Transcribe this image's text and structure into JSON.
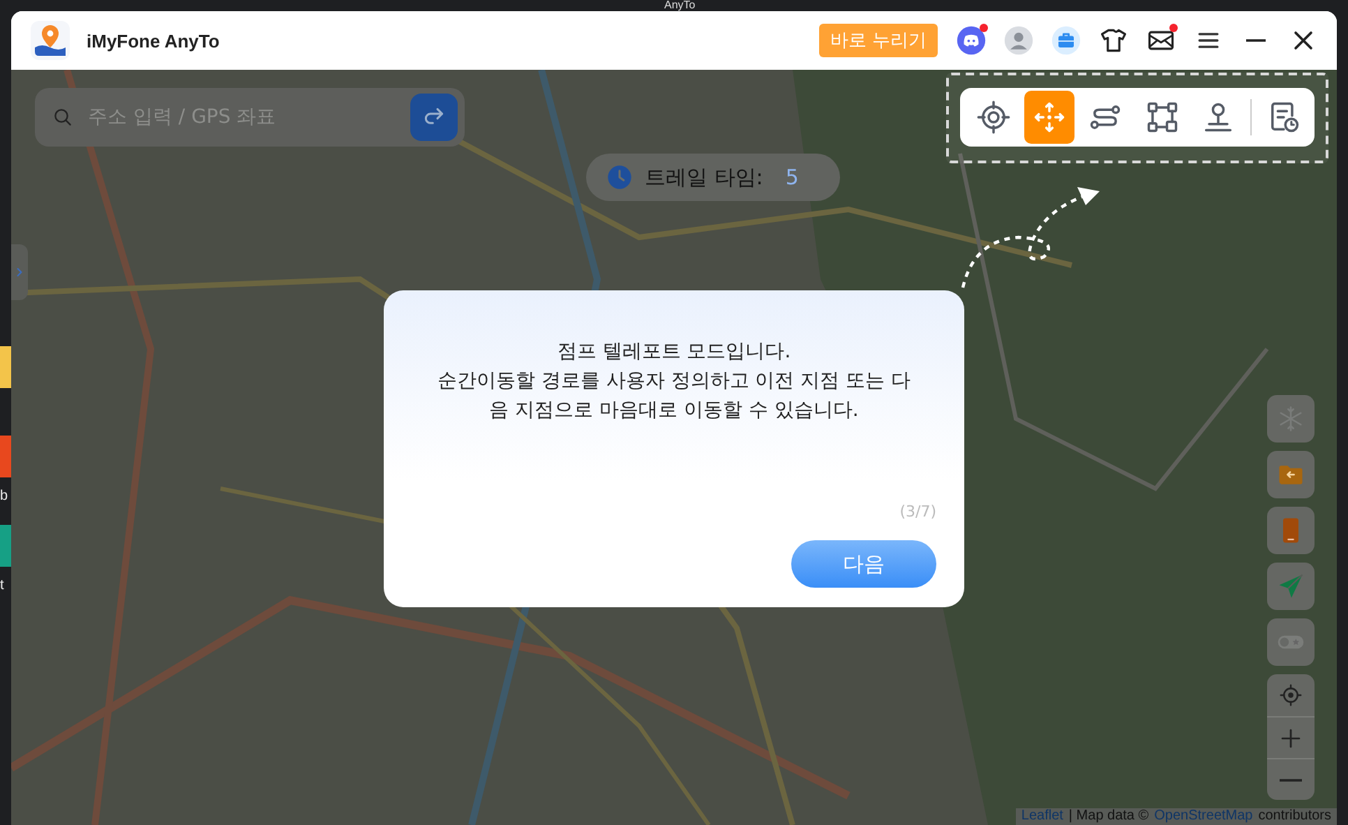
{
  "desktop": {
    "title": "AnyTo",
    "icon_labels": [
      "b",
      "t"
    ]
  },
  "window": {
    "title": "iMyFone AnyTo",
    "promo_button": "바로 누리기",
    "icons": [
      {
        "kind": "discord",
        "badge": true
      },
      {
        "kind": "user",
        "badge": false
      },
      {
        "kind": "briefcase",
        "badge": false
      },
      {
        "kind": "shirt",
        "badge": false
      },
      {
        "kind": "mail",
        "badge": true
      },
      {
        "kind": "menu",
        "badge": false
      },
      {
        "kind": "minimize",
        "badge": false
      },
      {
        "kind": "close",
        "badge": false
      }
    ]
  },
  "search": {
    "placeholder": "주소 입력 / GPS 좌표"
  },
  "trail_time": {
    "label": "트레일 타임:",
    "value": "5"
  },
  "mode_tools": [
    {
      "kind": "teleport",
      "selected": false
    },
    {
      "kind": "jump",
      "selected": true
    },
    {
      "kind": "two_spot",
      "selected": false
    },
    {
      "kind": "multi_spot",
      "selected": false
    },
    {
      "kind": "joystick",
      "selected": false
    },
    {
      "kind": "history",
      "selected": false
    }
  ],
  "tutorial": {
    "text": "점프 텔레포트 모드입니다.\n순간이동할 경로를 사용자 정의하고 이전 지점 또는 다\n음 지점으로 마음대로 이동할 수 있습니다.",
    "step": "(3/7)",
    "next_button": "다음"
  },
  "side_tools": [
    {
      "kind": "cooldown"
    },
    {
      "kind": "folder"
    },
    {
      "kind": "device"
    },
    {
      "kind": "send"
    },
    {
      "kind": "toggle"
    }
  ],
  "zoom_controls": [
    {
      "kind": "locate"
    },
    {
      "kind": "zoom_in"
    },
    {
      "kind": "zoom_out"
    }
  ],
  "attribution": {
    "link": "Leaflet",
    "text": "| Map data ©",
    "source_link": "OpenStreetMap",
    "suffix": "contributors"
  }
}
